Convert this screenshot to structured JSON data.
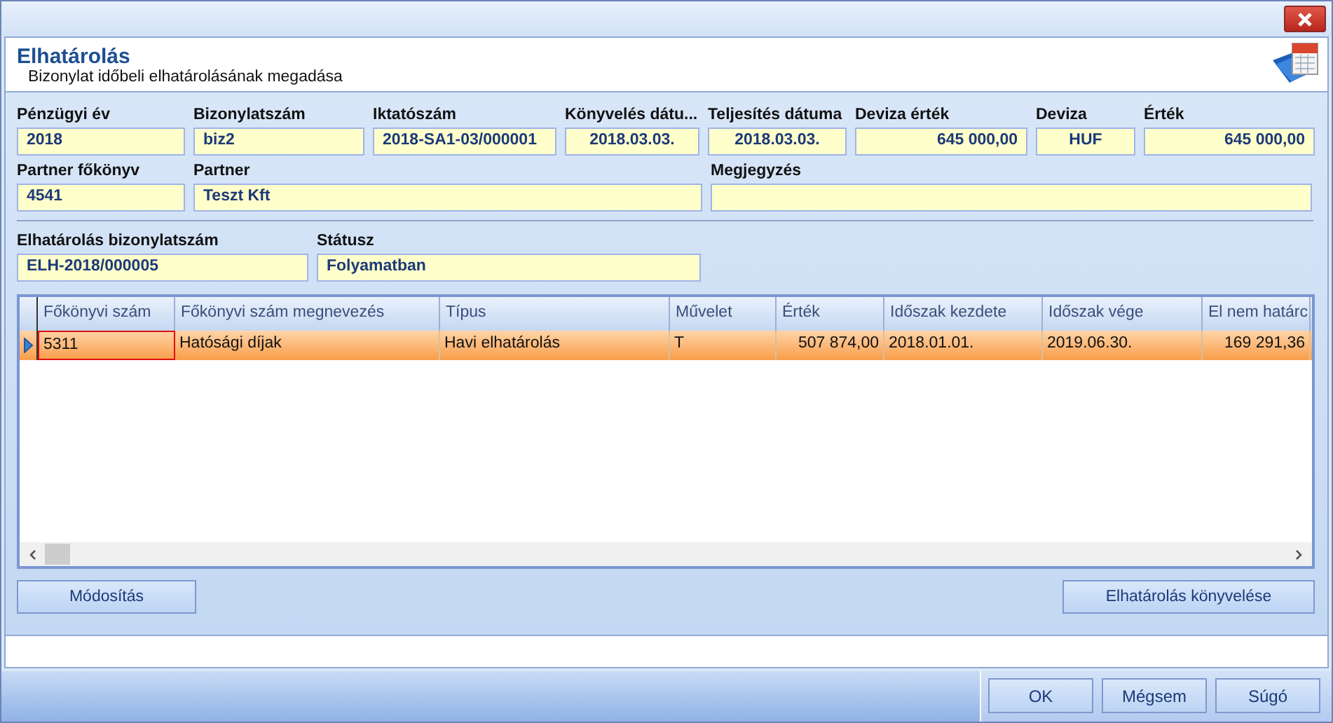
{
  "header": {
    "title": "Elhatárolás",
    "subtitle": "Bizonylat időbeli elhatárolásának megadása"
  },
  "form_rows": [
    [
      {
        "label": "Pénzügyi év",
        "value": "2018"
      },
      {
        "label": "Bizonylatszám",
        "value": "biz2"
      },
      {
        "label": "Iktatószám",
        "value": "2018-SA1-03/000001"
      },
      {
        "label": "Könyvelés dátu...",
        "value": "2018.03.03."
      },
      {
        "label": "Teljesítés dátuma",
        "value": "2018.03.03."
      },
      {
        "label": "Deviza érték",
        "value": "645 000,00"
      },
      {
        "label": "Deviza",
        "value": "HUF"
      },
      {
        "label": "Érték",
        "value": "645 000,00"
      }
    ],
    [
      {
        "label": "Partner főkönyv",
        "value": "4541"
      },
      {
        "label": "Partner",
        "value": "Teszt Kft"
      },
      {
        "label": "Megjegyzés"
      }
    ],
    [
      {
        "label": "Elhatárolás bizonylatszám",
        "value": "ELH-2018/000005"
      },
      {
        "label": "Státusz",
        "value": "Folyamatban"
      }
    ]
  ],
  "table": {
    "columns": [
      "Főkönyvi szám",
      "Főkönyvi szám megnevezés",
      "Típus",
      "Művelet",
      "Érték",
      "Időszak kezdete",
      "Időszak vége",
      "El nem határc"
    ],
    "rows": [
      {
        "selected": true,
        "cells": [
          "5311",
          "Hatósági díjak",
          "Havi elhatárolás",
          "T",
          "507 874,00",
          "2018.01.01.",
          "2019.06.30.",
          "169 291,36"
        ]
      }
    ]
  },
  "actions": [
    "Módosítás",
    "Elhatárolás könyvelése"
  ],
  "buttons": [
    "OK",
    "Mégsem",
    "Súgó"
  ]
}
